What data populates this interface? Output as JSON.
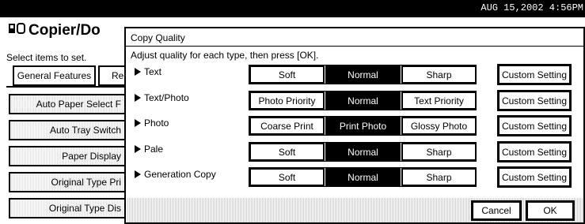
{
  "status": {
    "datetime": "AUG  15,2002  4:56PM"
  },
  "background": {
    "title": "Copier/Do",
    "instruction": "Select items to set.",
    "tabs": [
      "General Features",
      "Re"
    ],
    "buttons": [
      "Auto Paper Select F",
      "Auto Tray Switch",
      "Paper Display",
      "Original Type Pri",
      "Original Type Dis"
    ]
  },
  "dialog": {
    "title": "Copy Quality",
    "instruction": "Adjust quality for each type, then press [OK].",
    "rows": [
      {
        "label": "Text",
        "options": [
          "Soft",
          "Normal",
          "Sharp"
        ],
        "selected": 1,
        "custom": "Custom Setting"
      },
      {
        "label": "Text/Photo",
        "options": [
          "Photo Priority",
          "Normal",
          "Text Priority"
        ],
        "selected": 1,
        "custom": "Custom Setting"
      },
      {
        "label": "Photo",
        "options": [
          "Coarse Print",
          "Print Photo",
          "Glossy Photo"
        ],
        "selected": 1,
        "custom": "Custom Setting"
      },
      {
        "label": "Pale",
        "options": [
          "Soft",
          "Normal",
          "Sharp"
        ],
        "selected": 1,
        "custom": "Custom Setting"
      },
      {
        "label": "Generation Copy",
        "options": [
          "Soft",
          "Normal",
          "Sharp"
        ],
        "selected": 1,
        "custom": "Custom Setting"
      }
    ],
    "cancel_label": "Cancel",
    "ok_label": "OK"
  }
}
